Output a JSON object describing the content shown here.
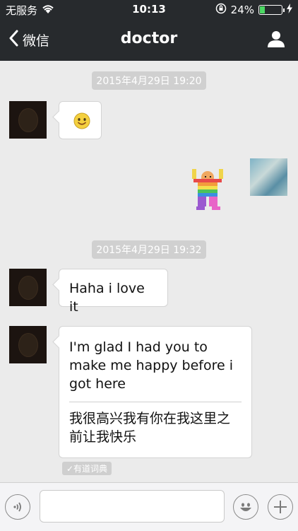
{
  "status": {
    "carrier": "无服务",
    "time": "10:13",
    "battery_percent": "24%",
    "battery_level": 0.24
  },
  "nav": {
    "back_label": "微信",
    "title": "doctor"
  },
  "messages": [
    {
      "type": "timestamp",
      "text": "2015年4月29日 19:20"
    },
    {
      "type": "received_emoji",
      "icon": "smiley-emoji-icon"
    },
    {
      "type": "sent_sticker",
      "icon": "rainbow-dancer-sticker"
    },
    {
      "type": "timestamp",
      "text": "2015年4月29日 19:32"
    },
    {
      "type": "received_text",
      "text": "Haha i love it"
    },
    {
      "type": "received_text_translated",
      "text": "I'm glad I had you to make me happy before i got here",
      "translation": "我很高兴我有你在我这里之前让我快乐",
      "translation_source": "✓有道词典"
    }
  ],
  "input": {
    "placeholder": ""
  },
  "colors": {
    "nav_bg": "#272a2d",
    "chat_bg": "#ebebeb",
    "battery_fill": "#4cd964"
  }
}
